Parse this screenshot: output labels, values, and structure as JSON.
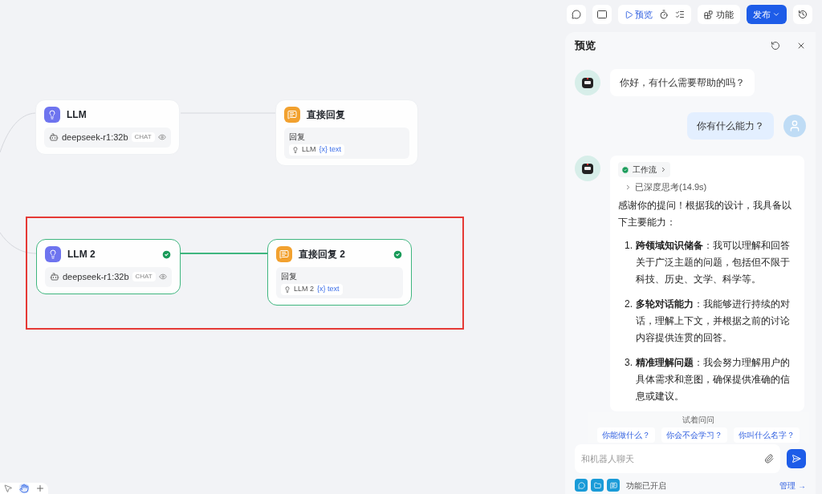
{
  "toolbar": {
    "preview_button": "预览",
    "features_button": "功能",
    "publish_button": "发布"
  },
  "canvas": {
    "nodes": [
      {
        "kind": "llm",
        "title": "LLM",
        "model": "deepseek-r1:32b",
        "tag": "CHAT",
        "done": false
      },
      {
        "kind": "reply",
        "title": "直接回复",
        "label": "回复",
        "source": "LLM",
        "variable": "{x} text",
        "done": false
      },
      {
        "kind": "llm",
        "title": "LLM 2",
        "model": "deepseek-r1:32b",
        "tag": "CHAT",
        "done": true
      },
      {
        "kind": "reply",
        "title": "直接回复 2",
        "label": "回复",
        "source": "LLM 2",
        "variable": "{x} text",
        "done": true
      }
    ]
  },
  "preview": {
    "title": "预览",
    "messages": [
      {
        "kind": "bot",
        "text": "你好，有什么需要帮助的吗？"
      },
      {
        "kind": "user",
        "text": "你有什么能力？"
      },
      {
        "kind": "answer",
        "workflow": "工作流",
        "thinking": "已深度思考(14.9s)",
        "intro": "感谢你的提问！根据我的设计，我具备以下主要能力：",
        "items": [
          {
            "number": "1.",
            "text": "**跨领域知识储备**：我可以理解和回答关于广泛主题的问题，包括但不限于科技、历史、文学、科学等。"
          },
          {
            "number": "2.",
            "text": "**多轮对话能力**：我能够进行持续的对话，理解上下文，并根据之前的讨论内容提供连贯的回答。"
          },
          {
            "number": "3.",
            "text": "**精准理解问题**：我会努力理解用户的具体需求和意图，确保提供准确的信息或建议。"
          }
        ]
      }
    ],
    "suggestions_title": "试着问问",
    "suggestions": [
      "你能做什么？",
      "你会不会学习？",
      "你叫什么名字？"
    ],
    "input_placeholder": "和机器人聊天",
    "features_status": "功能已开启",
    "manage_link": "管理 →"
  }
}
